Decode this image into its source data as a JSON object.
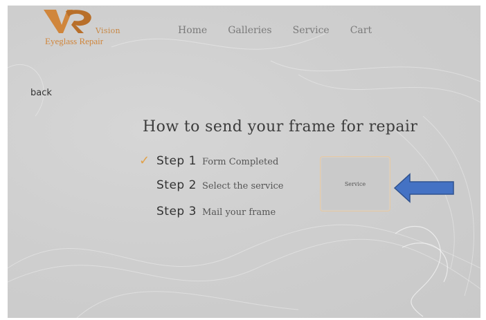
{
  "logo": {
    "word": "Vision",
    "subtitle": "Eyeglass Repair",
    "color": "#d0863c"
  },
  "nav": {
    "items": [
      "Home",
      "Galleries",
      "Service",
      "Cart"
    ]
  },
  "back_label": "back",
  "title": "How to send your frame for repair",
  "steps": [
    {
      "num": "Step 1",
      "text": "Form Completed",
      "done": true
    },
    {
      "num": "Step 2",
      "text": "Select the service",
      "done": false
    },
    {
      "num": "Step 3",
      "text": "Mail your frame",
      "done": false
    }
  ],
  "service_button": {
    "label": "Service"
  },
  "annotation": {
    "arrow_color": "#4472c4",
    "arrow_icon": "left-arrow-icon"
  },
  "icons": {
    "check": "✓"
  }
}
